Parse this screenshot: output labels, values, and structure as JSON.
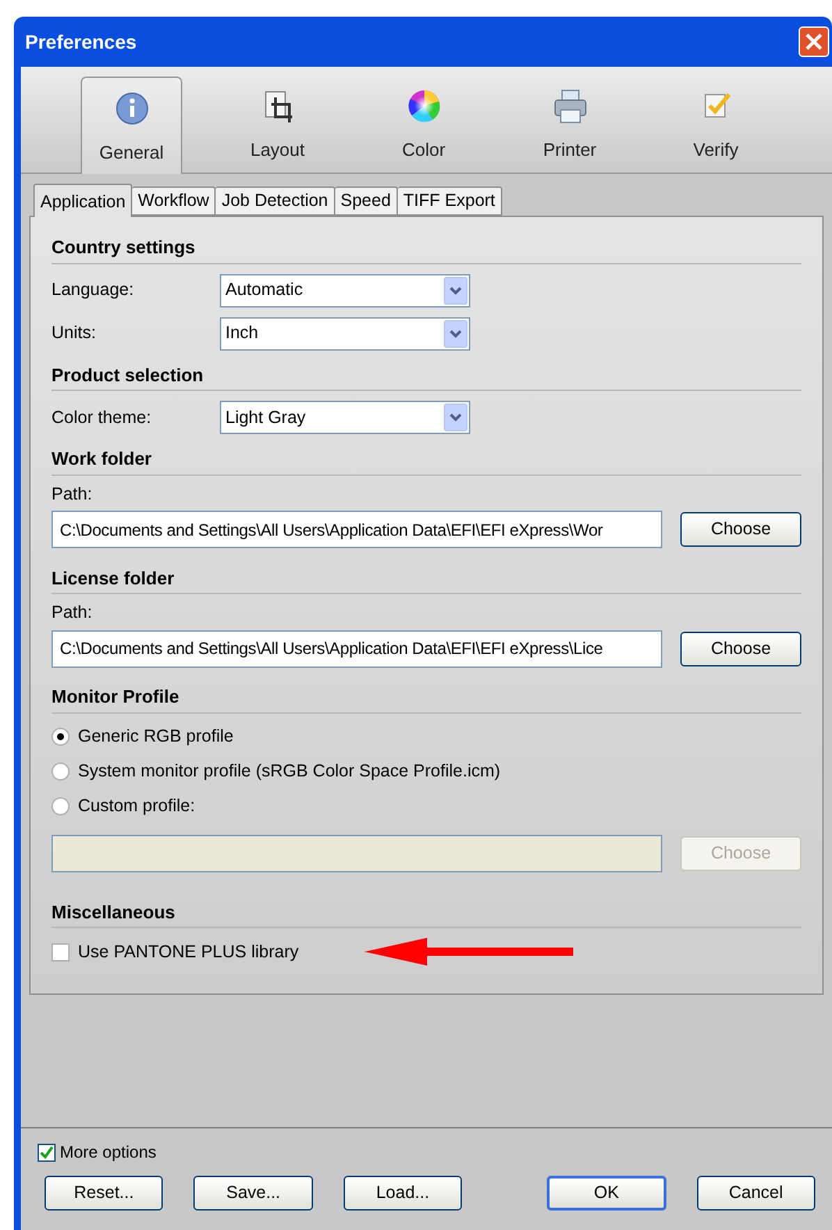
{
  "window": {
    "title": "Preferences"
  },
  "categories": [
    {
      "label": "General",
      "kind": "info",
      "selected": true
    },
    {
      "label": "Layout",
      "kind": "crop",
      "selected": false
    },
    {
      "label": "Color",
      "kind": "wheel",
      "selected": false
    },
    {
      "label": "Printer",
      "kind": "printer",
      "selected": false
    },
    {
      "label": "Verify",
      "kind": "verify",
      "selected": false
    }
  ],
  "tabs": [
    {
      "label": "Application",
      "selected": true
    },
    {
      "label": "Workflow",
      "selected": false
    },
    {
      "label": "Job Detection",
      "selected": false
    },
    {
      "label": "Speed",
      "selected": false
    },
    {
      "label": "TIFF Export",
      "selected": false
    }
  ],
  "sections": [
    {
      "title": "Country settings",
      "kind": "selects",
      "fields": [
        {
          "label": "Language:",
          "value": "Automatic"
        },
        {
          "label": "Units:",
          "value": "Inch"
        }
      ]
    },
    {
      "title": "Product selection",
      "kind": "selects",
      "fields": [
        {
          "label": "Color theme:",
          "value": "Light Gray"
        }
      ]
    },
    {
      "title": "Work folder",
      "kind": "path",
      "label": "Path:",
      "value": "C:\\Documents and Settings\\All Users\\Application Data\\EFI\\EFI eXpress\\Wor",
      "button": "Choose"
    },
    {
      "title": "License folder",
      "kind": "path",
      "label": "Path:",
      "value": "C:\\Documents and Settings\\All Users\\Application Data\\EFI\\EFI eXpress\\Lice",
      "button": "Choose"
    },
    {
      "title": "Monitor Profile",
      "kind": "radios",
      "options": [
        {
          "label": "Generic RGB profile",
          "selected": true
        },
        {
          "label": "System monitor profile (sRGB Color Space Profile.icm)",
          "selected": false
        },
        {
          "label": "Custom profile:",
          "selected": false
        }
      ],
      "custom_path": {
        "disabled": true,
        "button": "Choose"
      }
    },
    {
      "title": "Miscellaneous",
      "kind": "checks",
      "options": [
        {
          "label": "Use PANTONE PLUS library",
          "checked": false
        }
      ]
    }
  ],
  "more_options": {
    "label": "More options",
    "checked": true
  },
  "buttons": [
    {
      "label": "Reset...",
      "default": false
    },
    {
      "label": "Save...",
      "default": false
    },
    {
      "label": "Load...",
      "default": false
    },
    {
      "label": "OK",
      "default": true
    },
    {
      "label": "Cancel",
      "default": false
    }
  ]
}
